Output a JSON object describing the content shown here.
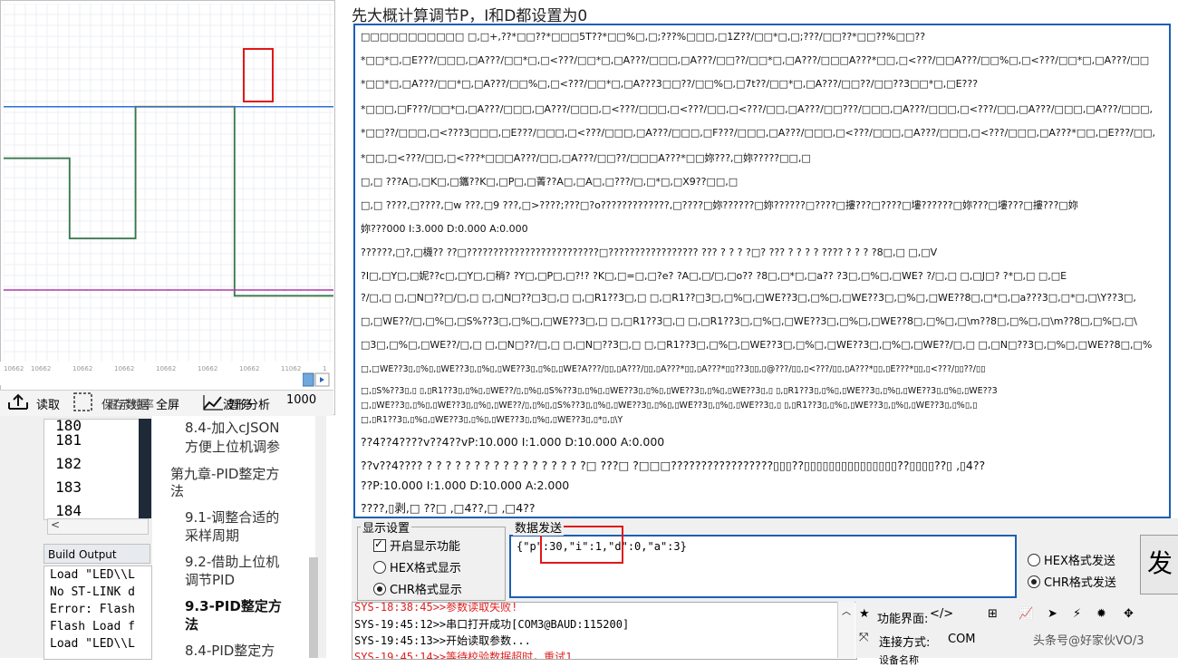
{
  "caption": "先大概计算调节P，I和D都设置为0",
  "chart_window": {
    "x_tick_labels": [
      "10662",
      "10662",
      "10662",
      "10662",
      "10662",
      "10662",
      "10662",
      "11062",
      "1"
    ],
    "toolbar": {
      "read_label": "读取",
      "fullscreen_label": "全屏",
      "save_label": "保存数据",
      "freq_label": "显示频率",
      "analysis_label": "波形分析",
      "pause_label": "暂停",
      "points_value": "1000"
    }
  },
  "ide": {
    "line_numbers": [
      "180",
      "181",
      "182",
      "183",
      "184"
    ],
    "build_output_title": "Build Output",
    "build_lines": [
      "Load \"LED\\\\L",
      "No ST-LINK d",
      "Error: Flash",
      "Flash Load f",
      "Load \"LED\\\\L"
    ],
    "toc": [
      {
        "label": "8.4-加入cJSON",
        "bold": false
      },
      {
        "label": "方便上位机调参",
        "bold": false
      },
      {
        "label": "第九章-PID整定方",
        "bold": false
      },
      {
        "label": "法",
        "bold": false
      },
      {
        "label": "9.1-调整合适的",
        "bold": false
      },
      {
        "label": "采样周期",
        "bold": false
      },
      {
        "label": "9.2-借助上位机",
        "bold": false
      },
      {
        "label": "调节PID",
        "bold": false
      },
      {
        "label": "9.3-PID整定方",
        "bold": true
      },
      {
        "label": "法",
        "bold": true
      },
      {
        "label": "8.4-PID整定方",
        "bold": false
      }
    ]
  },
  "terminal_lines": [
    "□□□□□□□□□□□ □,□+,??*□□??*□□□5T??*□□%□,□;???%□□□,□1Z??/□□*□,□;???/□□??*□□??%□□??",
    "*□□*□,□E???/□□□,□A???/□□*□,□<???/□□*□,□A???/□□□,□A???/□□??/□□*□,□A???/□□□A???*□□,□<???/□□A???/□□%□,□<???/□□*□,□A???/□□",
    "*□□*□,□A???/□□*□,□A???/□□%□,□<???/□□*□,□A???3□□??/□□%□,□7t??/□□*□,□A???/□□??/□□??3□□*□,□E???",
    "*□□□,□F???/□□*□,□A???/□□□,□A???/□□□,□<???/□□□,□<???/□□,□<???/□□,□A???/□□???/□□□,□A???/□□□,□<???/□□,□A???/□□□,□A???/□□□,",
    "*□□??/□□□,□<???3□□□,□E???/□□□,□<???/□□□,□A???/□□□,□F???/□□□,□A???/□□□,□<???/□□□,□A???/□□□,□<???/□□□,□A???*□□,□E???/□□,",
    "*□□,□<???/□□,□<???*□□□A???/□□,□A???/□□??/□□□A???*□□妳???,□妳?????□□,□",
    "□,□  ???A□,□K□,□鑴??K□,□P□,□菁??A□,□A□,□???/□,□*□,□X9??□□,□",
    "□,□  ????,□????,□w   ???,□9 ???,□>????;???□?o?????????????,□????□妳??????□妳??????□????□摟???□????□塿??????□妳???□塿???□摟???□妳",
    "妳???000  I:3.000  D:0.000  A:0.000",
    "??????,□?,□櫗??  ??□?????????????????????????□?????????????????   ???   ?   ?   ?   ?□?   ???   ?   ?   ?   ?   ????   ?   ?   ?   ?8□,□ □,□V",
    "  ?I□,□Y□,□妮??c□,□Y□,□稍?   ?Y□,□P□,□?!?   ?K□,□=□,□?e?   ?A□,□/□,□o??   ?8□,□*□,□a??   ?3□,□%□,□WE?   ?/□,□  □,□J□?   ?*□,□  □,□E",
    "  ?/□,□ □,□N□??□/□,□ □,□N□??□3□,□ □,□R1??3□,□ □,□R1??□3□,□%□,□WE??3□,□%□,□WE??3□,□%□,□WE??8□,□*□,□a???3□,□*□,□\\Y??3□,",
    "□,□WE??/□,□%□,□S%??3□,□%□,□WE??3□,□ □,□R1??3□,□ □,□R1??3□,□%□,□WE??3□,□%□,□WE??8□,□%□,□\\m??8□,□%□,□\\m??8□,□%□,□\\",
    "□3□,□%□,□WE??/□,□ □,□N□??/□,□ □,□N□??3□,□ □,□R1??3□,□%□,□WE??3□,□%□,□WE??3□,□%□,□WE??/□,□ □,□N□??3□,□%□,□WE??8□,□%",
    "□,□WE??3▯,▯%▯,▯WE??3▯,▯%▯,▯WE??3▯,▯%▯,▯WE?A???/▯▯,▯A???/▯▯,▯A???*▯▯,▯A???*▯▯??3▯▯,▯@???/▯▯,▯<???/▯▯,▯A???*▯▯,▯E???*▯▯,▯<???/▯▯??/▯▯",
    "□,▯S%??3▯,▯ ▯,▯R1??3▯,▯%▯,▯WE??/▯,▯%▯,▯S%??3▯,▯%▯,▯WE??3▯,▯%▯,▯WE??3▯,▯%▯,▯WE??3▯,▯ ▯,▯R1??3▯,▯%▯,▯WE??3▯,▯%▯,▯WE??3▯,▯%▯,▯WE??3",
    "□,▯WE??3▯,▯%▯,▯WE??3▯,▯%▯,▯WE??/▯,▯%▯,▯S%??3▯,▯%▯,▯WE??3▯,▯%▯,▯WE??3▯,▯%▯,▯WE??3▯,▯ ▯,▯R1??3▯,▯%▯,▯WE??3▯,▯%▯,▯WE??3▯,▯%▯,▯",
    "□,▯R1??3▯,▯%▯,▯WE??3▯,▯%▯,▯WE??3▯,▯%▯,▯WE??3▯,▯*▯,▯\\Y",
    "??4??4????v??4??vP:10.000  I:1.000  D:10.000 A:0.000",
    "??v??4????   ?   ?   ?   ?   ?   ?   ?   ?   ?   ?   ?   ?   ?   ?   ?   ?   ?□   ???□   ?□□□?????????????????▯▯▯??▯▯▯▯▯▯▯▯▯▯▯▯▯▯▯??▯▯▯▯??▯   ,▯4??",
    "??P:10.000  I:1.000  D:10.000 A:2.000",
    "????,▯剥,□   ??□   ,□4??,□   ,□4??"
  ],
  "display_settings": {
    "title": "显示设置",
    "enable_display": "开启显示功能",
    "hex_display": "HEX格式显示",
    "chr_display": "CHR格式显示"
  },
  "data_send": {
    "title": "数据发送",
    "text": "{\"p\":30,\"i\":1,\"d\":0,\"a\":3}",
    "hex_send": "HEX格式发送",
    "chr_send": "CHR格式发送",
    "send_label": "发"
  },
  "log_lines": [
    {
      "text": "SYS-18:38:45>>参数读取失败!",
      "red": true
    },
    {
      "text": "SYS-19:45:12>>串口打开成功[COM3@BAUD:115200]",
      "red": false
    },
    {
      "text": "SYS-19:45:13>>开始读取参数...",
      "red": false
    },
    {
      "text": "SYS-19:45:14>>等待校验数据超时，重试1",
      "red": true
    }
  ],
  "function_panel": {
    "title": "功能界面:",
    "connect_label": "连接方式:",
    "connect_value": "COM",
    "watermark": "头条号@好家伙VO/3",
    "partial": "设备名称"
  },
  "chart_data": {
    "type": "line",
    "title": "",
    "xlabel": "",
    "ylabel": "",
    "grid": true,
    "x": [
      0,
      10,
      20,
      30,
      40,
      50,
      60,
      70,
      80,
      90,
      100,
      110,
      120,
      130,
      140,
      150,
      160,
      170,
      180,
      190,
      200
    ],
    "series": [
      {
        "color": "#c8a000",
        "values": [
          46,
          46,
          46,
          46,
          18,
          18,
          18,
          18,
          64,
          64,
          64,
          64,
          64,
          64,
          -2,
          -2,
          -2,
          -2,
          -2,
          -2,
          -2
        ]
      },
      {
        "color": "#1f7a7a",
        "values": [
          46,
          46,
          46,
          46,
          18,
          18,
          18,
          18,
          64,
          64,
          64,
          64,
          64,
          64,
          -2,
          -2,
          -2,
          -2,
          -2,
          -2,
          -2
        ]
      },
      {
        "color": "#2e6eda",
        "values": [
          64,
          64,
          64,
          64,
          64,
          64,
          64,
          64,
          64,
          64,
          64,
          64,
          64,
          64,
          64,
          64,
          64,
          64,
          64,
          64,
          64
        ]
      },
      {
        "color": "#b03aa8",
        "values": [
          0,
          0,
          0,
          0,
          0,
          0,
          0,
          0,
          0,
          0,
          0,
          0,
          0,
          0,
          0,
          0,
          0,
          0,
          0,
          0,
          0
        ]
      }
    ]
  }
}
